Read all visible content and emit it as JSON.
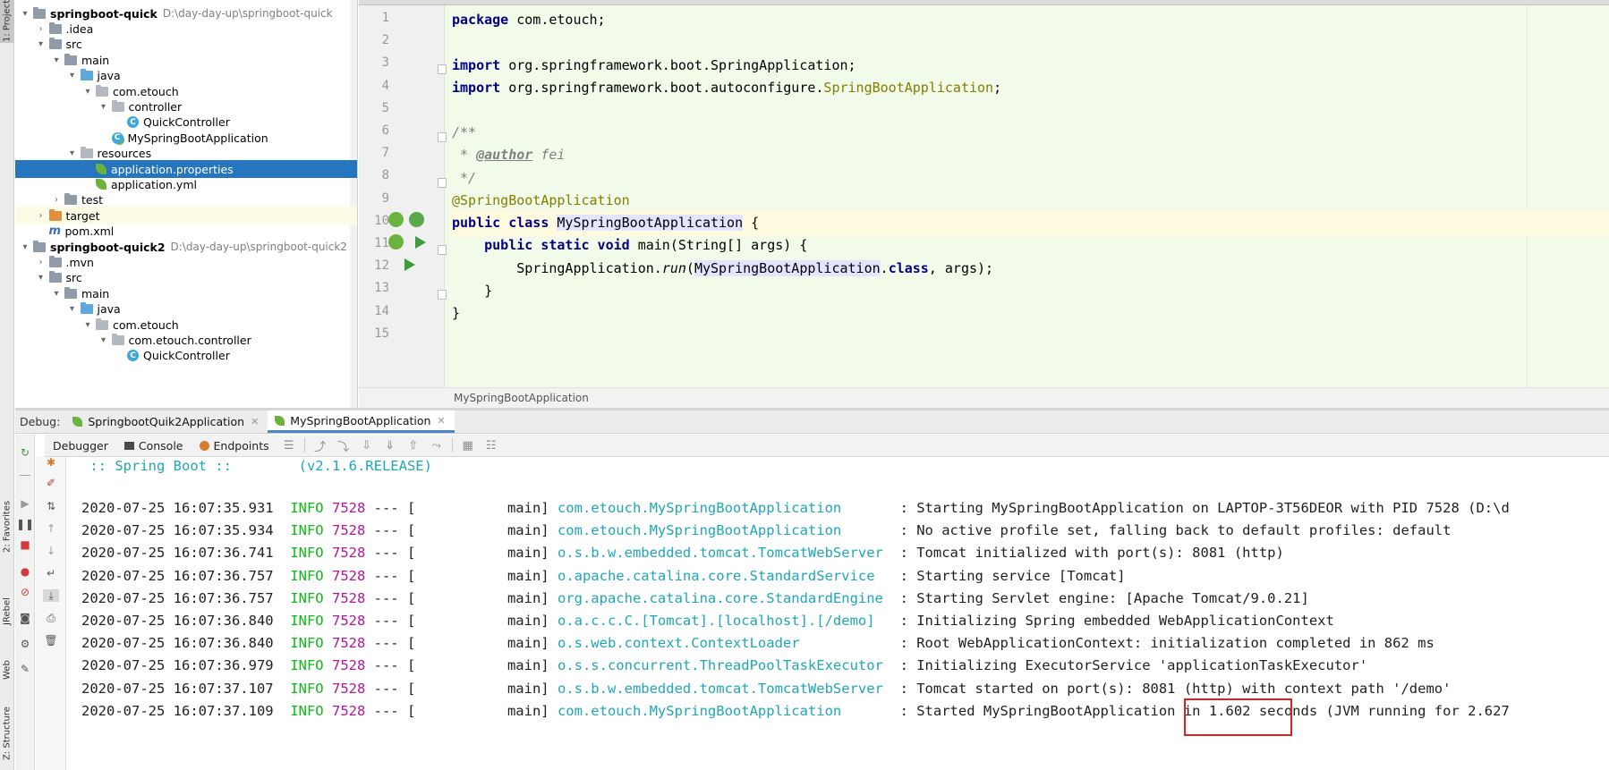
{
  "side_strip": {
    "project_tab": "1: Project",
    "favorites_tab": "2: Favorites",
    "jrebel_tab": "JRebel",
    "web_tab": "Web",
    "structure_tab": "Z: Structure"
  },
  "project_tree": {
    "rows": [
      {
        "label": "springboot-quick",
        "path": "D:\\day-day-up\\springboot-quick",
        "depth": 0,
        "icon": "module-folder-icon",
        "arrow": "▾",
        "bold": true
      },
      {
        "label": ".idea",
        "depth": 1,
        "icon": "folder-icon",
        "arrow": "›"
      },
      {
        "label": "src",
        "depth": 1,
        "icon": "folder-icon",
        "arrow": "▾"
      },
      {
        "label": "main",
        "depth": 2,
        "icon": "folder-icon",
        "arrow": "▾"
      },
      {
        "label": "java",
        "depth": 3,
        "icon": "source-folder-icon",
        "arrow": "▾"
      },
      {
        "label": "com.etouch",
        "depth": 4,
        "icon": "package-icon",
        "arrow": "▾"
      },
      {
        "label": "controller",
        "depth": 5,
        "icon": "package-icon",
        "arrow": "▾"
      },
      {
        "label": "QuickController",
        "depth": 6,
        "icon": "class-icon",
        "arrow": ""
      },
      {
        "label": "MySpringBootApplication",
        "depth": 5,
        "icon": "spring-class-icon",
        "arrow": ""
      },
      {
        "label": "resources",
        "depth": 3,
        "icon": "resources-folder-icon",
        "arrow": "▾"
      },
      {
        "label": "application.properties",
        "depth": 4,
        "icon": "spring-properties-icon",
        "arrow": "",
        "selected": true
      },
      {
        "label": "application.yml",
        "depth": 4,
        "icon": "spring-yml-icon",
        "arrow": ""
      },
      {
        "label": "test",
        "depth": 2,
        "icon": "folder-icon",
        "arrow": "›"
      },
      {
        "label": "target",
        "depth": 1,
        "icon": "target-folder-icon",
        "arrow": "›",
        "target": true
      },
      {
        "label": "pom.xml",
        "depth": 1,
        "icon": "maven-icon",
        "arrow": ""
      },
      {
        "label": "springboot-quick2",
        "path": "D:\\day-day-up\\springboot-quick2",
        "depth": 0,
        "icon": "module-folder-icon",
        "arrow": "▾",
        "bold": true
      },
      {
        "label": ".mvn",
        "depth": 1,
        "icon": "folder-icon",
        "arrow": "›"
      },
      {
        "label": "src",
        "depth": 1,
        "icon": "folder-icon",
        "arrow": "▾"
      },
      {
        "label": "main",
        "depth": 2,
        "icon": "folder-icon",
        "arrow": "▾"
      },
      {
        "label": "java",
        "depth": 3,
        "icon": "source-folder-icon",
        "arrow": "▾"
      },
      {
        "label": "com.etouch",
        "depth": 4,
        "icon": "package-icon",
        "arrow": "▾"
      },
      {
        "label": "com.etouch.controller",
        "depth": 5,
        "icon": "package-icon",
        "arrow": "▾"
      },
      {
        "label": "QuickController",
        "depth": 6,
        "icon": "class-icon",
        "arrow": ""
      }
    ]
  },
  "editor": {
    "line_numbers": [
      "1",
      "2",
      "3",
      "4",
      "5",
      "6",
      "7",
      "8",
      "9",
      "10",
      "11",
      "12",
      "13",
      "14",
      "15"
    ],
    "code": {
      "l1_kw": "package",
      "l1_rest": " com.etouch;",
      "l3_kw": "import",
      "l3_rest": " org.springframework.boot.SpringApplication;",
      "l4_kw": "import",
      "l4_rest": " org.springframework.boot.autoconfigure.",
      "l4_ann": "SpringBootApplication",
      "l4_end": ";",
      "l6": "/**",
      "l7_pre": " * ",
      "l7_tag": "@author",
      "l7_val": " fei",
      "l8": " */",
      "l9": "@SpringBootApplication",
      "l10_kw": "public class",
      "l10_cls": "MySpringBootApplication",
      "l10_end": " {",
      "l11_kw": "public static void",
      "l11_rest": " main(String[] args) {",
      "l12_a": "SpringApplication.",
      "l12_run": "run",
      "l12_b": "(",
      "l12_cls": "MySpringBootApplication",
      "l12_dot": ".",
      "l12_kw": "class",
      "l12_end": ", args);",
      "l13": "}",
      "l14": "}"
    },
    "breadcrumb": "MySpringBootApplication"
  },
  "debug": {
    "title": "Debug:",
    "run_tabs": [
      {
        "label": "SpringbootQuik2Application",
        "active": false
      },
      {
        "label": "MySpringBootApplication",
        "active": true
      }
    ],
    "toolbar_tabs": {
      "debugger": "Debugger",
      "console": "Console",
      "endpoints": "Endpoints"
    }
  },
  "console": {
    "banner": " :: Spring Boot ::        (v2.1.6.RELEASE)",
    "logs": [
      {
        "ts": "2020-07-25 16:07:35.931",
        "lvl": "INFO",
        "pid": "7528",
        "thread": " --- [           main] ",
        "logger": "com.etouch.MySpringBootApplication      ",
        "msg": " : Starting MySpringBootApplication on LAPTOP-3T56DEOR with PID 7528 (D:\\d"
      },
      {
        "ts": "2020-07-25 16:07:35.934",
        "lvl": "INFO",
        "pid": "7528",
        "thread": " --- [           main] ",
        "logger": "com.etouch.MySpringBootApplication      ",
        "msg": " : No active profile set, falling back to default profiles: default"
      },
      {
        "ts": "2020-07-25 16:07:36.741",
        "lvl": "INFO",
        "pid": "7528",
        "thread": " --- [           main] ",
        "logger": "o.s.b.w.embedded.tomcat.TomcatWebServer ",
        "msg": " : Tomcat initialized with port(s): 8081 (http)"
      },
      {
        "ts": "2020-07-25 16:07:36.757",
        "lvl": "INFO",
        "pid": "7528",
        "thread": " --- [           main] ",
        "logger": "o.apache.catalina.core.StandardService  ",
        "msg": " : Starting service [Tomcat]"
      },
      {
        "ts": "2020-07-25 16:07:36.757",
        "lvl": "INFO",
        "pid": "7528",
        "thread": " --- [           main] ",
        "logger": "org.apache.catalina.core.StandardEngine ",
        "msg": " : Starting Servlet engine: [Apache Tomcat/9.0.21]"
      },
      {
        "ts": "2020-07-25 16:07:36.840",
        "lvl": "INFO",
        "pid": "7528",
        "thread": " --- [           main] ",
        "logger": "o.a.c.c.C.[Tomcat].[localhost].[/demo]  ",
        "msg": " : Initializing Spring embedded WebApplicationContext"
      },
      {
        "ts": "2020-07-25 16:07:36.840",
        "lvl": "INFO",
        "pid": "7528",
        "thread": " --- [           main] ",
        "logger": "o.s.web.context.ContextLoader           ",
        "msg": " : Root WebApplicationContext: initialization completed in 862 ms"
      },
      {
        "ts": "2020-07-25 16:07:36.979",
        "lvl": "INFO",
        "pid": "7528",
        "thread": " --- [           main] ",
        "logger": "o.s.s.concurrent.ThreadPoolTaskExecutor ",
        "msg": " : Initializing ExecutorService 'applicationTaskExecutor'"
      },
      {
        "ts": "2020-07-25 16:07:37.107",
        "lvl": "INFO",
        "pid": "7528",
        "thread": " --- [           main] ",
        "logger": "o.s.b.w.embedded.tomcat.TomcatWebServer ",
        "msg": " : Tomcat started on port(s): 8081 (http) with context path '/demo'"
      },
      {
        "ts": "2020-07-25 16:07:37.109",
        "lvl": "INFO",
        "pid": "7528",
        "thread": " --- [           main] ",
        "logger": "com.etouch.MySpringBootApplication      ",
        "msg": " : Started MySpringBootApplication in 1.602 seconds (JVM running for 2.627"
      }
    ]
  },
  "colors": {
    "selection": "#2675bf",
    "editor_bg": "#f2fbe9",
    "keyword": "#000080",
    "annotation": "#808000",
    "log_level": "#11b81c",
    "log_pid": "#b3149b",
    "log_logger": "#1fa6b9",
    "highlight_box": "#e02020"
  }
}
